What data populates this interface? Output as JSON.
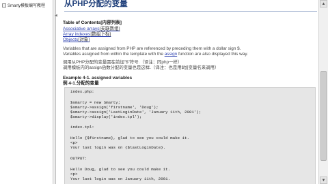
{
  "sidebar": {
    "item_label": "Smarty模板编写教程",
    "item_icon": "book-icon"
  },
  "page": {
    "title": "从PHP分配的变量",
    "toc_head": "Table of Contents[内容列表]",
    "toc": [
      {
        "label": "Associative arrays",
        "tail": "[关联数组]"
      },
      {
        "label": "Array indexes",
        "tail": "[数组下标]"
      },
      {
        "label": "Objects",
        "tail": "[对象]"
      }
    ],
    "para1_line1": "Variables that are assigned from PHP are referenced by preceding them with a dollar sign $.",
    "para1_line2_pre": "Variables assigned from within the template with the ",
    "para1_line2_link": "assign",
    "para1_line2_post": " function are also displayed this way.",
    "para2_line1": "调用从PHP分配的变量需在前加\"$\"符号.（译注：同php一样）",
    "para2_line2": "调用模板内的assign函数分配的变量也是这样.（译注：也是用$加变量名来调用）",
    "example_title_en": "Example 4-1. assigned variables",
    "example_title_cn": "例 4-1.分配的变量"
  },
  "code": [
    "index.php:",
    "",
    "$smarty = new Smarty;",
    "$smarty->assign('firstname', 'Doug');",
    "$smarty->assign('LastLoginDate', 'January 11th, 2001');",
    "$smarty->display('index.tpl');",
    "",
    "index.tpl:",
    "",
    "Hello {$firstname}, glad to see you could make it.",
    "<p>",
    "Your last login was on {$lastLoginDate}.",
    "",
    "OUTPUT:",
    "",
    "Hello Doug, glad to see you could make it.",
    "<p>",
    "Your last login was on January 11th, 2001."
  ],
  "scrollbar": {
    "up_icon": "▲",
    "down_icon": "▼"
  }
}
